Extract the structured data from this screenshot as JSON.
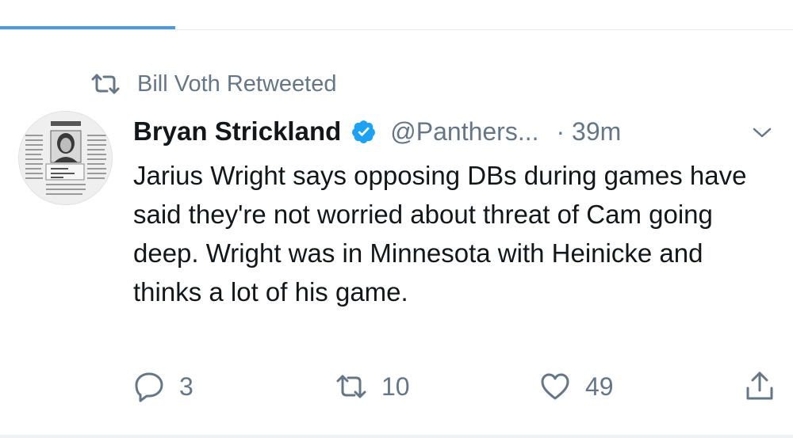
{
  "retweet_context": {
    "text": "Bill Voth Retweeted",
    "icon": "retweet-icon"
  },
  "tweet": {
    "author_name": "Bryan Strickland",
    "verified": true,
    "handle": "@Panthers...",
    "time": "· 39m",
    "text": "Jarius Wright says opposing DBs during games have said they're not worried about threat of Cam going deep. Wright was in Minnesota with Heinicke and thinks a lot of his game.",
    "actions": {
      "replies": "3",
      "retweets": "10",
      "likes": "49"
    }
  },
  "colors": {
    "accent": "#1da1f2",
    "tab_indicator": "#4a9be0",
    "muted_text": "#657786",
    "primary_text": "#14171a"
  }
}
